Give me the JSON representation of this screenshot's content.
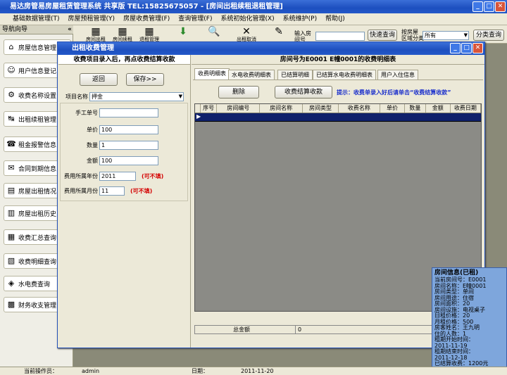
{
  "window": {
    "title": "易达房管易房屋租赁管理系统 共享版 TEL:15825675057 - [房间出租续租退租管理]"
  },
  "menu": [
    "基础数据管理(T)",
    "房屋预租管理(Y)",
    "房屋收费管理(F)",
    "查询管理(F)",
    "系统初始化管理(X)",
    "系统维护(P)",
    "帮助(J)"
  ],
  "toolbar": {
    "icons": [
      {
        "name": "room-booking-icon",
        "glyph": "▦",
        "label": "房间出租"
      },
      {
        "name": "room-renew-icon",
        "glyph": "▦",
        "label": "房间续租"
      },
      {
        "name": "room-return-icon",
        "glyph": "▦",
        "label": "退租管理"
      },
      {
        "name": "download-icon",
        "glyph": "⬇",
        "label": ""
      },
      {
        "name": "search-icon",
        "glyph": "🔍",
        "label": ""
      },
      {
        "name": "close-icon",
        "glyph": "✕",
        "label": "出租取消"
      },
      {
        "name": "edit-icon",
        "glyph": "✎",
        "label": ""
      }
    ],
    "input_room_label": "输入房",
    "input_room_sublabel": "间号",
    "quick_search_label": "快速查询",
    "by_area_label": "按房屋",
    "by_area_sublabel": "区域分类",
    "area_select_value": "所有",
    "classify_search_label": "分类查询"
  },
  "nav": {
    "header": "导航向导",
    "collapse": "«",
    "items": [
      {
        "label": "房屋信息管理",
        "icon": "house-icon",
        "glyph": "⌂"
      },
      {
        "label": "用户信息登记",
        "icon": "user-icon",
        "glyph": "☺"
      },
      {
        "label": "收费名称设置",
        "icon": "fee-name-icon",
        "glyph": "⚙"
      },
      {
        "label": "出租续租管理",
        "icon": "rent-icon",
        "glyph": "↹"
      },
      {
        "label": "租金报警信息",
        "icon": "alarm-icon",
        "glyph": "☎"
      },
      {
        "label": "合同到期信息",
        "icon": "contract-icon",
        "glyph": "✉"
      },
      {
        "label": "房屋出租情况",
        "icon": "rent-status-icon",
        "glyph": "▤"
      },
      {
        "label": "房屋出租历史",
        "icon": "history-icon",
        "glyph": "▥"
      },
      {
        "label": "收费汇总查询",
        "icon": "summary-icon",
        "glyph": "▦"
      },
      {
        "label": "收费明细查询",
        "icon": "detail-icon",
        "glyph": "▧"
      },
      {
        "label": "水电费查询",
        "icon": "utility-icon",
        "glyph": "◈"
      },
      {
        "label": "财务收支管理",
        "icon": "finance-icon",
        "glyph": "▩"
      }
    ]
  },
  "dialog": {
    "title": "出租收费管理",
    "left_header": "收费项目录入后，再点收费结算收款",
    "back_label": "返回",
    "save_label": "保存>>",
    "item_name_label": "项目名称",
    "item_name_value": "押金",
    "manual_no_label": "手工单号",
    "manual_no_value": "",
    "price_label": "单价",
    "price_value": "100",
    "qty_label": "数量",
    "qty_value": "1",
    "amount_label": "金额",
    "amount_value": "100",
    "year_label": "费用所属年份",
    "year_value": "2011",
    "month_label": "费用所属月份",
    "month_value": "11",
    "not_fill": "(可不填)",
    "right_header": "房间号为E0001  E幢0001的收费明细表",
    "tabs": [
      "收费明细表",
      "水电收费明细表",
      "已结算明细",
      "已结算水电收费明细表",
      "用户入住信息"
    ],
    "delete_label": "删除",
    "settle_label": "收费结算收款",
    "hint": "提示：收费单录入好后请单击“收费结算收款”",
    "columns": [
      "序号",
      "房间编号",
      "房间名称",
      "房间类型",
      "收费名称",
      "单价",
      "数量",
      "金额",
      "收费日期"
    ],
    "total_label": "总金额",
    "total_value": "0"
  },
  "room_info": {
    "title": "房间信息(已租)",
    "lines": [
      "当前房间号：E0001",
      "房间名称：E幢0001",
      "房间类型：单间",
      "房间用途：住宿",
      "房间面积：20",
      "房间设施：电视桌子",
      "日租价格：20",
      "月租价格：500",
      "房客姓名：王九明",
      "住的人数：1",
      "租期开始时间：",
      "2011-11-19",
      "租期结束时间：",
      "2011-12-18",
      "已结算收费：1200元"
    ]
  },
  "status": {
    "operator_label": "当前操作员：",
    "operator": "admin",
    "date_label": "日期：",
    "date": "2011-11-20"
  }
}
